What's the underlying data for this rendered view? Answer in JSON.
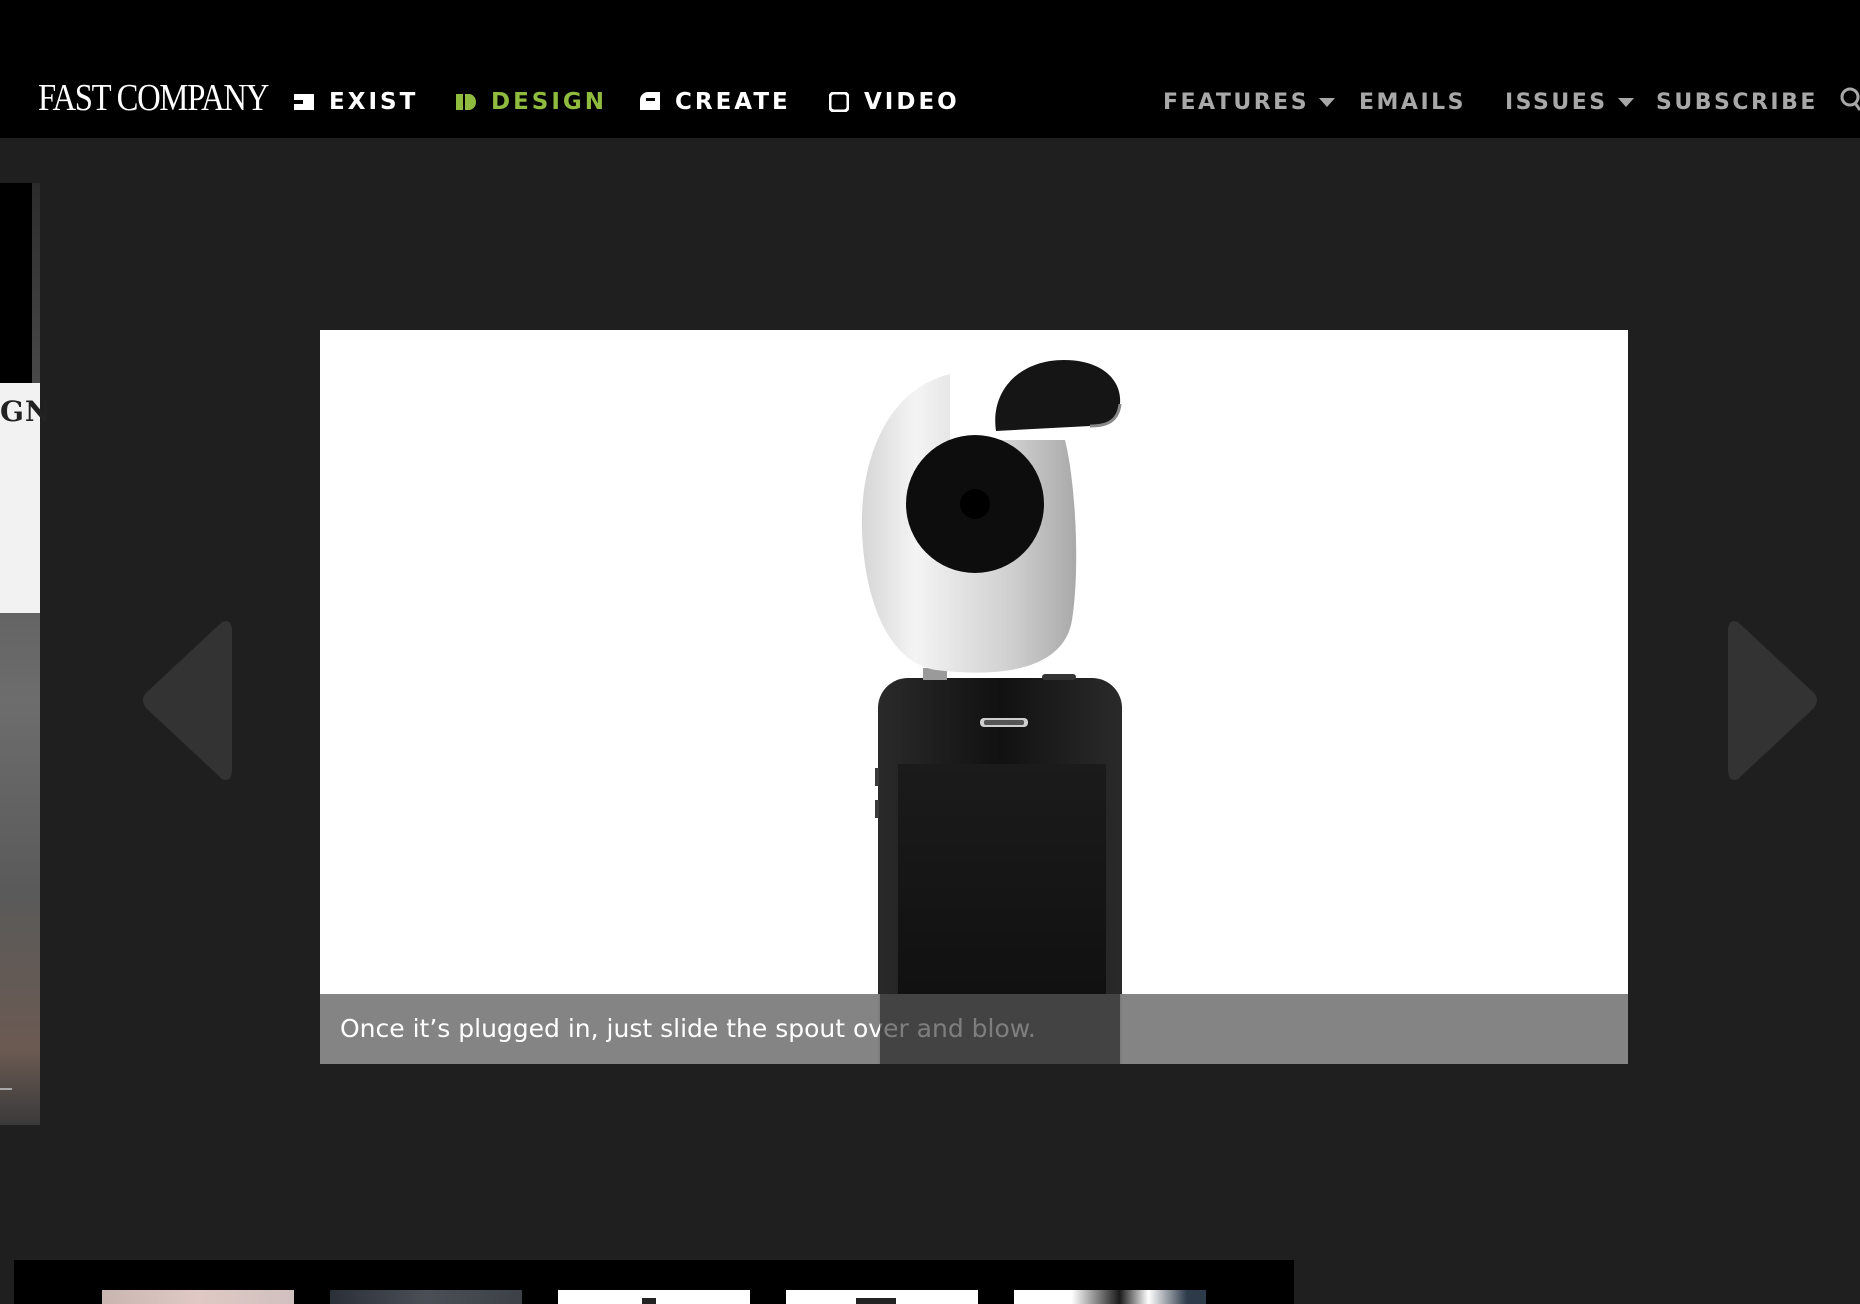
{
  "header": {
    "logo_text": "FAST COMPANY",
    "nav": [
      {
        "label": "EXIST",
        "icon": "exist-icon"
      },
      {
        "label": "DESIGN",
        "icon": "design-icon",
        "active": true
      },
      {
        "label": "CREATE",
        "icon": "create-icon"
      },
      {
        "label": "VIDEO",
        "icon": "video-icon"
      }
    ],
    "right_nav": [
      {
        "label": "FEATURES",
        "has_dropdown": true
      },
      {
        "label": "EMAILS",
        "has_dropdown": false
      },
      {
        "label": "ISSUES",
        "has_dropdown": true
      },
      {
        "label": "SUBSCRIBE",
        "has_dropdown": false
      }
    ],
    "search_icon": "search-icon"
  },
  "left_peek": {
    "partial_text": "GN"
  },
  "slideshow": {
    "caption": "Once it’s plugged in, just slide the spout over and blow.",
    "prev_icon": "chevron-left-icon",
    "next_icon": "chevron-right-icon",
    "thumbnail_count": 5
  },
  "colors": {
    "nav_bg": "#000000",
    "page_bg": "#1f1f1f",
    "design_accent": "#8fbb3e",
    "right_nav_text": "#a8a8a8",
    "caption_bg": "#808080"
  }
}
